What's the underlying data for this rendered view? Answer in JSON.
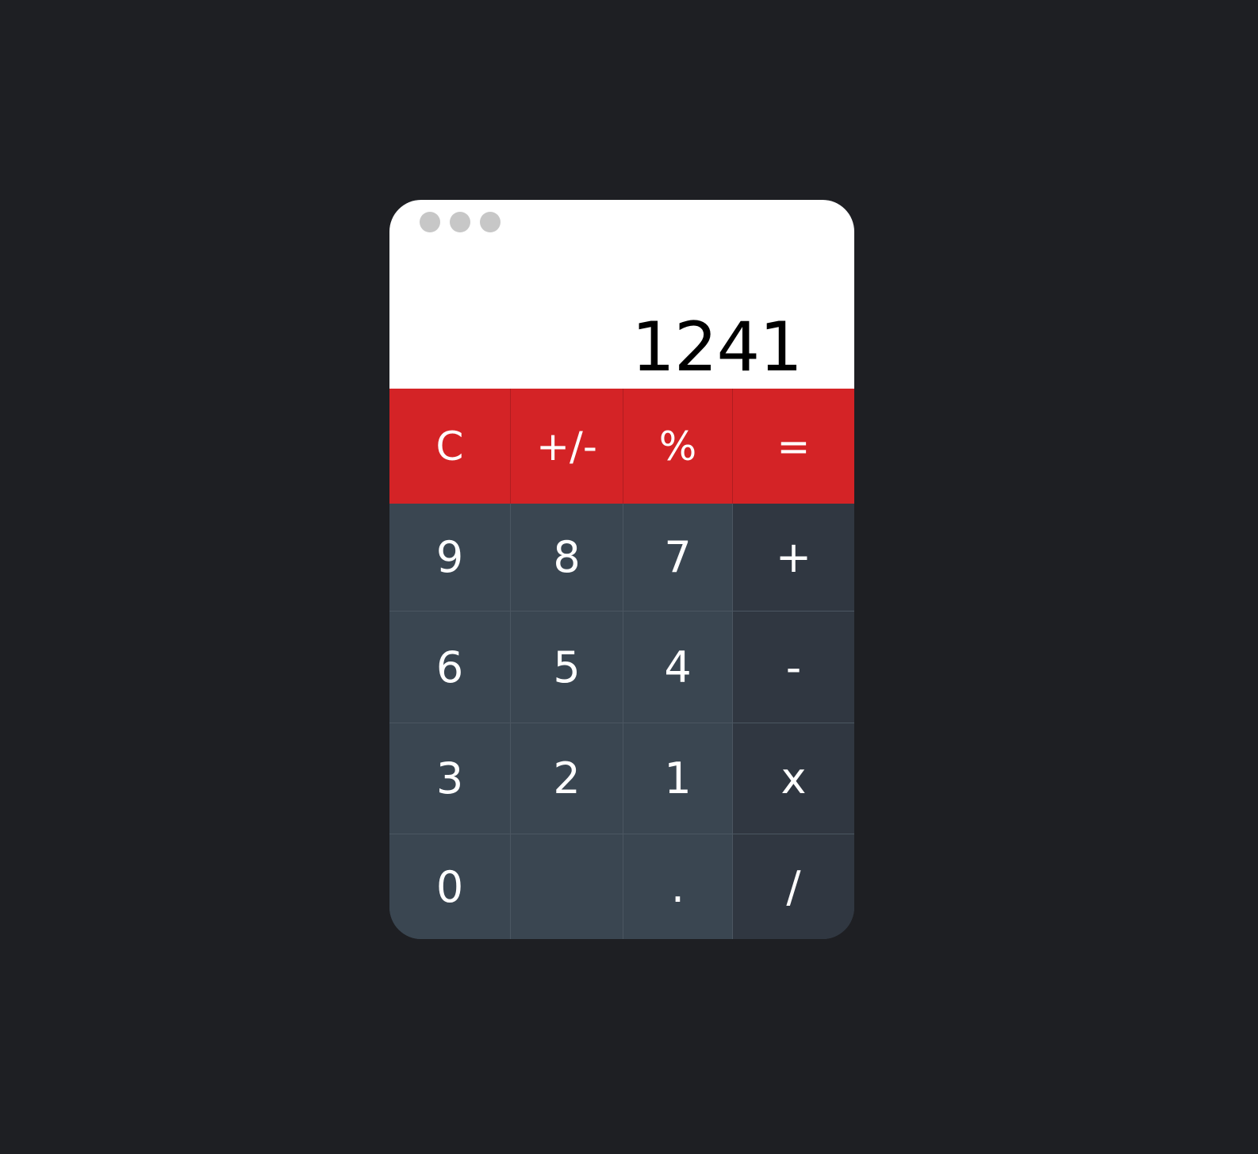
{
  "window": {
    "control_dots": [
      "window-dot-1",
      "window-dot-2",
      "window-dot-3"
    ]
  },
  "display": {
    "value": "1241"
  },
  "keys": {
    "clear": "C",
    "negate": "+/-",
    "percent": "%",
    "equals": "=",
    "nine": "9",
    "eight": "8",
    "seven": "7",
    "plus": "+",
    "six": "6",
    "five": "5",
    "four": "4",
    "minus": "-",
    "three": "3",
    "two": "2",
    "one": "1",
    "multiply": "x",
    "zero": "0",
    "blank": "",
    "decimal": ".",
    "divide": "/"
  },
  "colors": {
    "background": "#1e1f23",
    "display_bg": "#ffffff",
    "accent_red": "#d42326",
    "number_key_bg": "#3a4651",
    "operator_key_bg": "#303741",
    "key_text": "#ffffff",
    "display_text": "#000000"
  }
}
